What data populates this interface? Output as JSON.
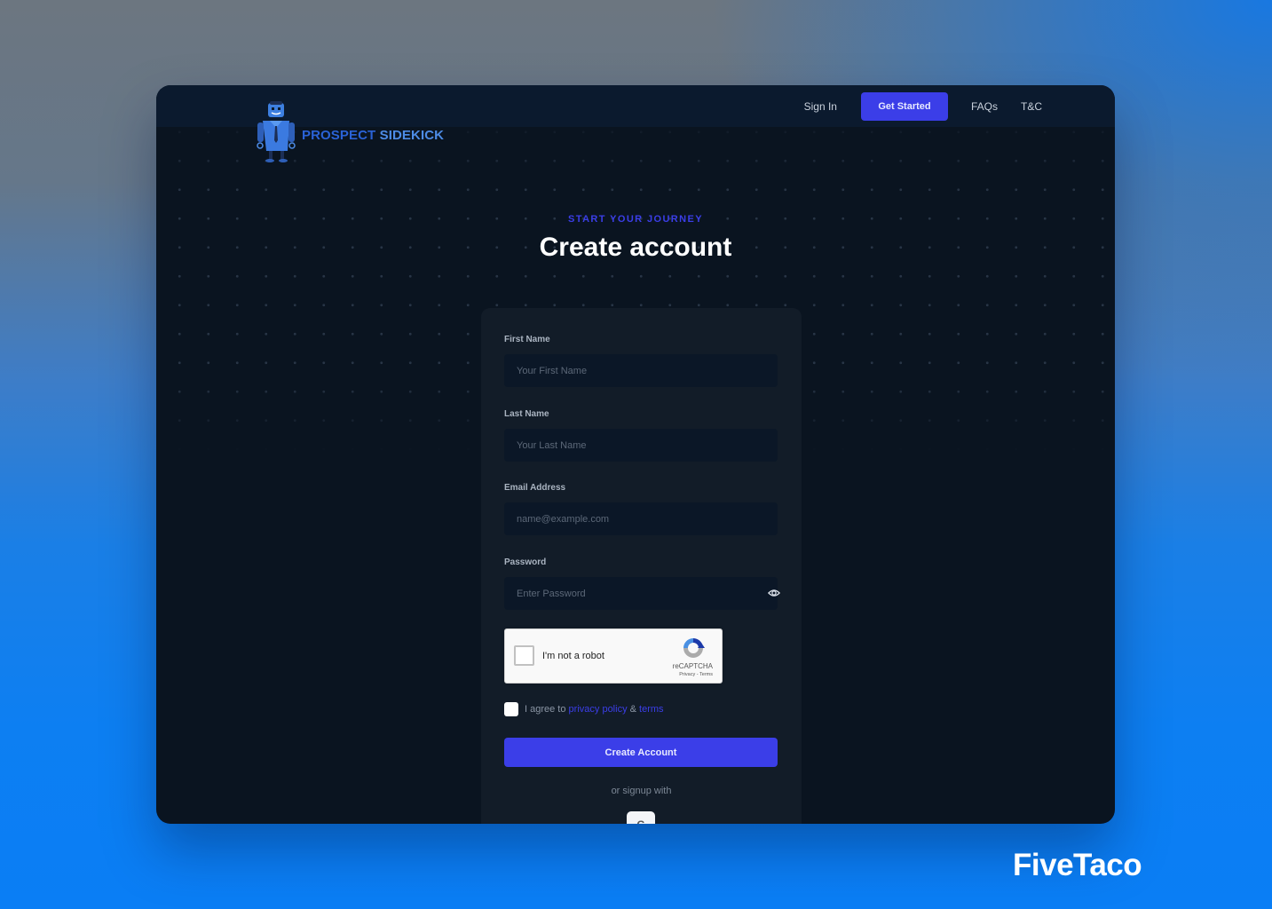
{
  "brand_watermark": "FiveTaco",
  "header": {
    "logo": {
      "icon": "robot-mascot-icon",
      "text_part1": "PROSPECT",
      "text_part2": "SIDEKICK"
    },
    "nav": {
      "sign_in": "Sign In",
      "get_started": "Get Started",
      "faqs": "FAQs",
      "tc": "T&C"
    }
  },
  "hero": {
    "eyebrow": "START YOUR JOURNEY",
    "title": "Create account"
  },
  "form": {
    "first_name": {
      "label": "First Name",
      "placeholder": "Your First Name",
      "value": ""
    },
    "last_name": {
      "label": "Last Name",
      "placeholder": "Your Last Name",
      "value": ""
    },
    "email": {
      "label": "Email Address",
      "placeholder": "name@example.com",
      "value": ""
    },
    "password": {
      "label": "Password",
      "placeholder": "Enter Password",
      "value": "",
      "toggle_icon": "eye-icon"
    },
    "recaptcha": {
      "label": "I'm not a robot",
      "brand": "reCAPTCHA",
      "links": "Privacy - Terms",
      "checked": false
    },
    "agree": {
      "prefix": "I agree to",
      "privacy_link": "privacy policy",
      "amp": "&",
      "terms_link": "terms",
      "checked": false
    },
    "submit_label": "Create Account",
    "or_text": "or signup with",
    "social": [
      {
        "name": "google",
        "icon": "google-icon",
        "glyph": "G"
      }
    ]
  },
  "colors": {
    "accent": "#3b3ee8",
    "window_bg": "#0a1420",
    "header_bg": "#0b1a2e",
    "card_bg": "#121c28",
    "input_bg": "#0b1727",
    "logo_blue_dark": "#2a62d6",
    "logo_blue_light": "#4d8ce6"
  }
}
